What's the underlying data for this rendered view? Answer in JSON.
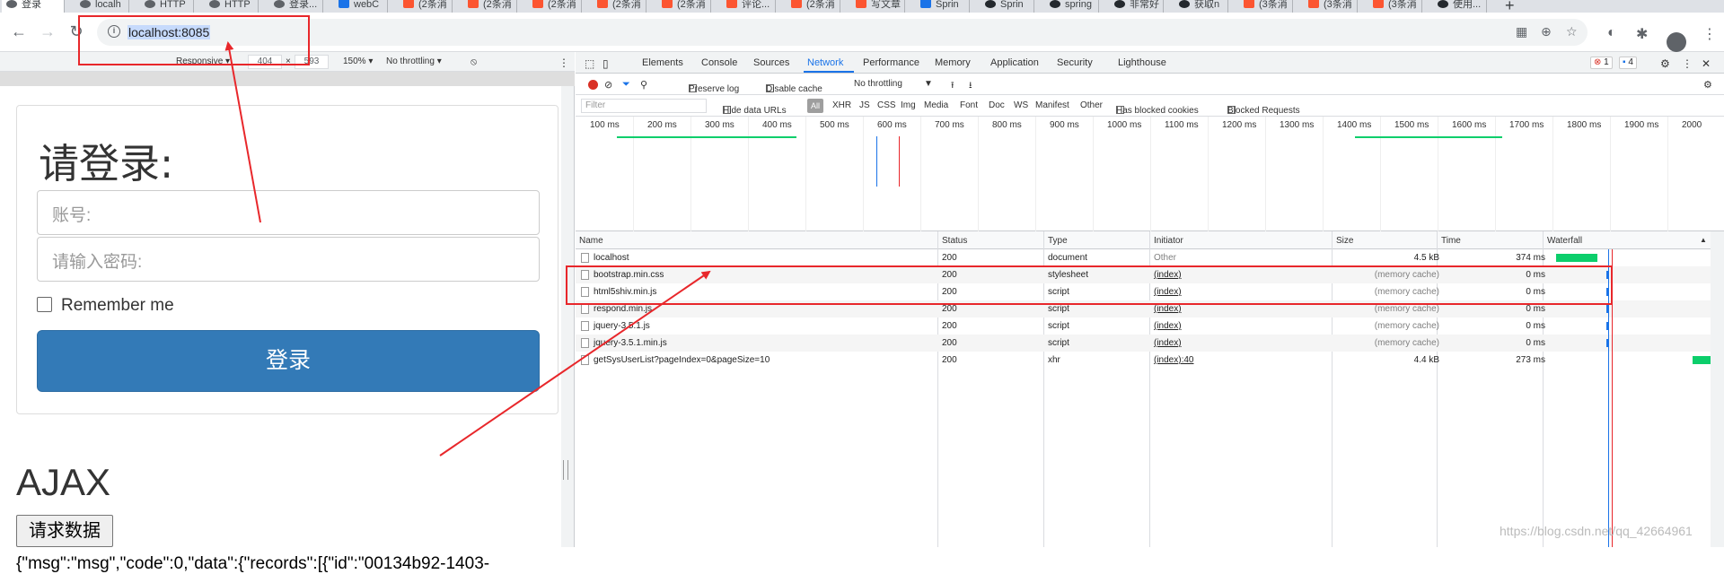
{
  "browser": {
    "tabs": [
      {
        "label": "登录",
        "icon": "globe-icon",
        "active": true
      },
      {
        "label": "localh",
        "icon": "globe-icon"
      },
      {
        "label": "HTTP",
        "icon": "globe-icon"
      },
      {
        "label": "HTTP",
        "icon": "globe-icon"
      },
      {
        "label": "登录...",
        "icon": "globe-icon"
      },
      {
        "label": "webC",
        "icon": "home-icon"
      },
      {
        "label": "(2条消",
        "icon": "csdn-icon"
      },
      {
        "label": "(2条消",
        "icon": "csdn-icon"
      },
      {
        "label": "(2条消",
        "icon": "csdn-icon"
      },
      {
        "label": "(2条消",
        "icon": "csdn-icon"
      },
      {
        "label": "(2条消",
        "icon": "csdn-icon"
      },
      {
        "label": "评论...",
        "icon": "csdn-icon"
      },
      {
        "label": "(2条消",
        "icon": "csdn-icon"
      },
      {
        "label": "写文章",
        "icon": "csdn-icon"
      },
      {
        "label": "Sprin",
        "icon": "spring-icon"
      },
      {
        "label": "Sprin",
        "icon": "github-icon"
      },
      {
        "label": "spring",
        "icon": "github-icon"
      },
      {
        "label": "非常好",
        "icon": "github-icon"
      },
      {
        "label": "获取n",
        "icon": "github-icon"
      },
      {
        "label": "(3条消",
        "icon": "csdn-icon"
      },
      {
        "label": "(3条消",
        "icon": "csdn-icon"
      },
      {
        "label": "(3条消",
        "icon": "csdn-icon"
      },
      {
        "label": "使用...",
        "icon": "github-icon"
      }
    ],
    "new_tab": "+",
    "url": "localhost:8085",
    "info_glyph": "i"
  },
  "device_toolbar": {
    "mode": "Responsive ▾",
    "width": "404",
    "times": "×",
    "height": "593",
    "zoom": "150% ▾",
    "throttle": "No throttling ▾"
  },
  "page": {
    "login_title": "请登录:",
    "account_placeholder": "账号:",
    "password_placeholder": "请输入密码:",
    "remember_label": "Remember me",
    "login_button": "登录",
    "ajax_title": "AJAX",
    "request_button": "请求数据",
    "json_output": "{\"msg\":\"msg\",\"code\":0,\"data\":{\"records\":[{\"id\":\"00134b92-1403-"
  },
  "devtools": {
    "tabs": [
      "Elements",
      "Console",
      "Sources",
      "Network",
      "Performance",
      "Memory",
      "Application",
      "Security",
      "Lighthouse"
    ],
    "active_tab": "Network",
    "error_count": "1",
    "message_count": "4",
    "toolbar": {
      "preserve_log": "Preserve log",
      "disable_cache": "Disable cache",
      "throttle": "No throttling"
    },
    "filter": {
      "placeholder": "Filter",
      "hide_data_urls": "Hide data URLs",
      "types": [
        "All",
        "XHR",
        "JS",
        "CSS",
        "Img",
        "Media",
        "Font",
        "Doc",
        "WS",
        "Manifest",
        "Other"
      ],
      "has_blocked_cookies": "Has blocked cookies",
      "blocked_requests": "Blocked Requests"
    },
    "timeline_ticks": [
      "100 ms",
      "200 ms",
      "300 ms",
      "400 ms",
      "500 ms",
      "600 ms",
      "700 ms",
      "800 ms",
      "900 ms",
      "1000 ms",
      "1100 ms",
      "1200 ms",
      "1300 ms",
      "1400 ms",
      "1500 ms",
      "1600 ms",
      "1700 ms",
      "1800 ms",
      "1900 ms",
      "2000"
    ],
    "columns": [
      "Name",
      "Status",
      "Type",
      "Initiator",
      "Size",
      "Time",
      "Waterfall"
    ],
    "requests": [
      {
        "name": "localhost",
        "status": "200",
        "type": "document",
        "initiator": "Other",
        "size": "4.5 kB",
        "time": "374 ms"
      },
      {
        "name": "bootstrap.min.css",
        "status": "200",
        "type": "stylesheet",
        "initiator": "(index)",
        "size": "(memory cache)",
        "time": "0 ms"
      },
      {
        "name": "html5shiv.min.js",
        "status": "200",
        "type": "script",
        "initiator": "(index)",
        "size": "(memory cache)",
        "time": "0 ms"
      },
      {
        "name": "respond.min.js",
        "status": "200",
        "type": "script",
        "initiator": "(index)",
        "size": "(memory cache)",
        "time": "0 ms"
      },
      {
        "name": "jquery-3.5.1.js",
        "status": "200",
        "type": "script",
        "initiator": "(index)",
        "size": "(memory cache)",
        "time": "0 ms"
      },
      {
        "name": "jquery-3.5.1.min.js",
        "status": "200",
        "type": "script",
        "initiator": "(index)",
        "size": "(memory cache)",
        "time": "0 ms"
      },
      {
        "name": "getSysUserList?pageIndex=0&pageSize=10",
        "status": "200",
        "type": "xhr",
        "initiator": "(index):40",
        "size": "4.4 kB",
        "time": "273 ms"
      }
    ]
  },
  "watermark": "https://blog.csdn.net/qq_42664961",
  "colors": {
    "annotation": "#e8272b",
    "primary_button": "#337ab7",
    "waterfall_green": "#0cce6b"
  }
}
